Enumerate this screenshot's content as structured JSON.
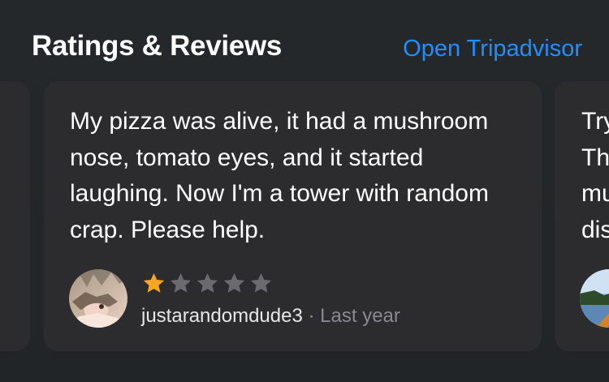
{
  "header": {
    "title": "Ratings & Reviews",
    "open_link": "Open Tripadvisor"
  },
  "review_main": {
    "text": "My pizza was alive, it had a mushroom nose, tomato eyes, and it started laughing. Now I'm a tower with random crap. Please help.",
    "rating": 1,
    "rating_max": 5,
    "author": "justarandomdude3",
    "separator": "·",
    "time": "Last year"
  },
  "review_next_peek": {
    "lines": [
      "Try",
      "Th",
      "mu",
      "dis"
    ]
  },
  "colors": {
    "accent_link": "#1f8fff",
    "star_filled": "#f5a623",
    "star_empty": "#6b6b6f",
    "card_bg": "#2c2c2e"
  }
}
